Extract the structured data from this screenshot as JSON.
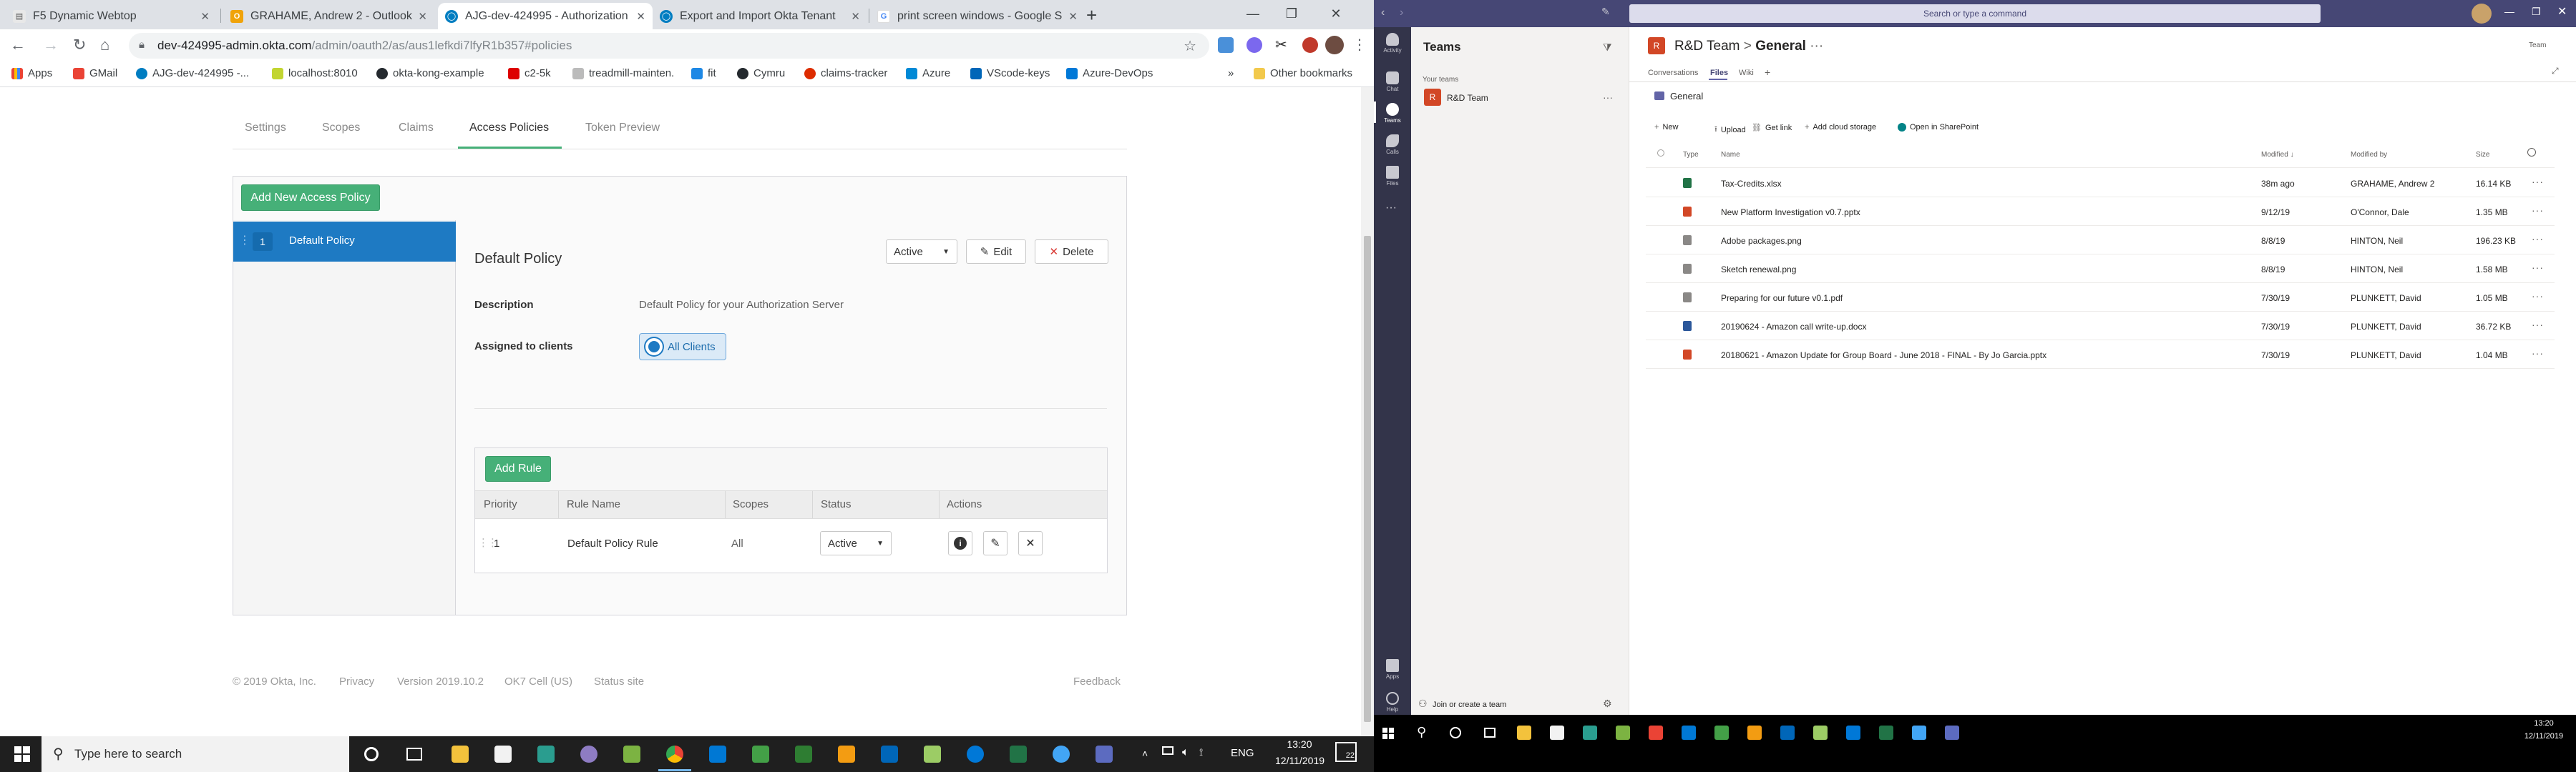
{
  "chrome": {
    "tabs": [
      {
        "title": "F5 Dynamic Webtop",
        "fav_color": "#e8e8e8",
        "fav_glyph": "▤"
      },
      {
        "title": "GRAHAME, Andrew 2 - Outlook",
        "fav_color": "#f0a30a",
        "fav_glyph": "O"
      },
      {
        "title": "AJG-dev-424995 - Authorization",
        "fav_color": "#007dc1",
        "fav_glyph": "◯"
      },
      {
        "title": "Export and Import Okta Tenant",
        "fav_color": "#007dc1",
        "fav_glyph": "◯"
      },
      {
        "title": "print screen windows - Google S",
        "fav_color": "#ffffff",
        "fav_glyph": "G"
      }
    ],
    "url_host": "dev-424995-admin.okta.com",
    "url_path": "/admin/oauth2/as/aus1lefkdi7lfyR1b357#policies",
    "bookmarks": [
      {
        "label": "Apps",
        "color": "#5f6368"
      },
      {
        "label": "GMail",
        "color": "#ea4335"
      },
      {
        "label": "AJG-dev-424995 -...",
        "color": "#007dc1"
      },
      {
        "label": "localhost:8010",
        "color": "#c2d531"
      },
      {
        "label": "okta-kong-example",
        "color": "#24292e"
      },
      {
        "label": "c2-5k",
        "color": "#d00"
      },
      {
        "label": "treadmill-mainten.",
        "color": "#888"
      },
      {
        "label": "fit",
        "color": "#1e88e5"
      },
      {
        "label": "Cymru",
        "color": "#24292e"
      },
      {
        "label": "claims-tracker",
        "color": "#dd2c00"
      },
      {
        "label": "Azure",
        "color": "#0089d6"
      },
      {
        "label": "VScode-keys",
        "color": "#0066b8"
      },
      {
        "label": "Azure-DevOps",
        "color": "#0078d7"
      }
    ],
    "more_bookmarks": "»",
    "other_bookmarks": "Other bookmarks"
  },
  "okta": {
    "tabs": [
      "Settings",
      "Scopes",
      "Claims",
      "Access Policies",
      "Token Preview"
    ],
    "active_tab": "Access Policies",
    "add_policy_label": "Add New Access Policy",
    "policy_list": [
      {
        "priority": "1",
        "name": "Default Policy"
      }
    ],
    "policy": {
      "title": "Default Policy",
      "status": "Active",
      "edit_label": "Edit",
      "delete_label": "Delete",
      "description_label": "Description",
      "description": "Default Policy for your Authorization Server",
      "assigned_label": "Assigned to clients",
      "assigned_value": "All Clients"
    },
    "add_rule_label": "Add Rule",
    "rule_columns": [
      "Priority",
      "Rule Name",
      "Scopes",
      "Status",
      "Actions"
    ],
    "rules": [
      {
        "priority": "1",
        "name": "Default Policy Rule",
        "scopes": "All",
        "status": "Active"
      }
    ],
    "footer": [
      "© 2019 Okta, Inc.",
      "Privacy",
      "Version 2019.10.2",
      "OK7 Cell (US)",
      "Status site"
    ],
    "feedback": "Feedback"
  },
  "taskbar_left": {
    "search_placeholder": "Type here to search",
    "lang": "ENG",
    "time": "13:20",
    "date": "12/11/2019",
    "notif_count": "22"
  },
  "teams": {
    "search_placeholder": "Search or type a command",
    "rail": [
      "Activity",
      "Chat",
      "Teams",
      "Calls",
      "Files",
      "Apps",
      "Help"
    ],
    "list_title": "Teams",
    "your_teams": "Your teams",
    "team_name": "R&D Team",
    "team_initials": "R",
    "join_label": "Join or create a team",
    "breadcrumb_team": "R&D Team",
    "breadcrumb_sep": ">",
    "channel": "General",
    "top_right": "Team",
    "channel_tabs": [
      "Conversations",
      "Files",
      "Wiki"
    ],
    "folder": "General",
    "actions": [
      "New",
      "Upload",
      "Get link",
      "Add cloud storage",
      "Open in SharePoint"
    ],
    "columns": [
      "Type",
      "Name",
      "Modified",
      "Modified by",
      "Size"
    ],
    "files": [
      {
        "name": "Tax-Credits.xlsx",
        "modified": "38m ago",
        "by": "GRAHAME, Andrew 2",
        "size": "16.14 KB",
        "kind": "xlsx"
      },
      {
        "name": "New Platform Investigation v0.7.pptx",
        "modified": "9/12/19",
        "by": "O'Connor, Dale",
        "size": "1.35 MB",
        "kind": "pptx"
      },
      {
        "name": "Adobe packages.png",
        "modified": "8/8/19",
        "by": "HINTON, Neil",
        "size": "196.23 KB",
        "kind": "png"
      },
      {
        "name": "Sketch renewal.png",
        "modified": "8/8/19",
        "by": "HINTON, Neil",
        "size": "1.58 MB",
        "kind": "png"
      },
      {
        "name": "Preparing for our future v0.1.pdf",
        "modified": "7/30/19",
        "by": "PLUNKETT, David",
        "size": "1.05 MB",
        "kind": "pdf"
      },
      {
        "name": "20190624 - Amazon call write-up.docx",
        "modified": "7/30/19",
        "by": "PLUNKETT, David",
        "size": "36.72 KB",
        "kind": "docx"
      },
      {
        "name": "20180621 - Amazon Update for Group Board - June 2018 - FINAL - By Jo Garcia.pptx",
        "modified": "7/30/19",
        "by": "PLUNKETT, David",
        "size": "1.04 MB",
        "kind": "pptx"
      }
    ],
    "kind_colors": {
      "xlsx": "#217346",
      "pptx": "#d24726",
      "png": "#8a8886",
      "pdf": "#8a8886",
      "docx": "#2b579a"
    }
  },
  "taskbar_right": {
    "time": "13:20",
    "date": "12/11/2019"
  }
}
